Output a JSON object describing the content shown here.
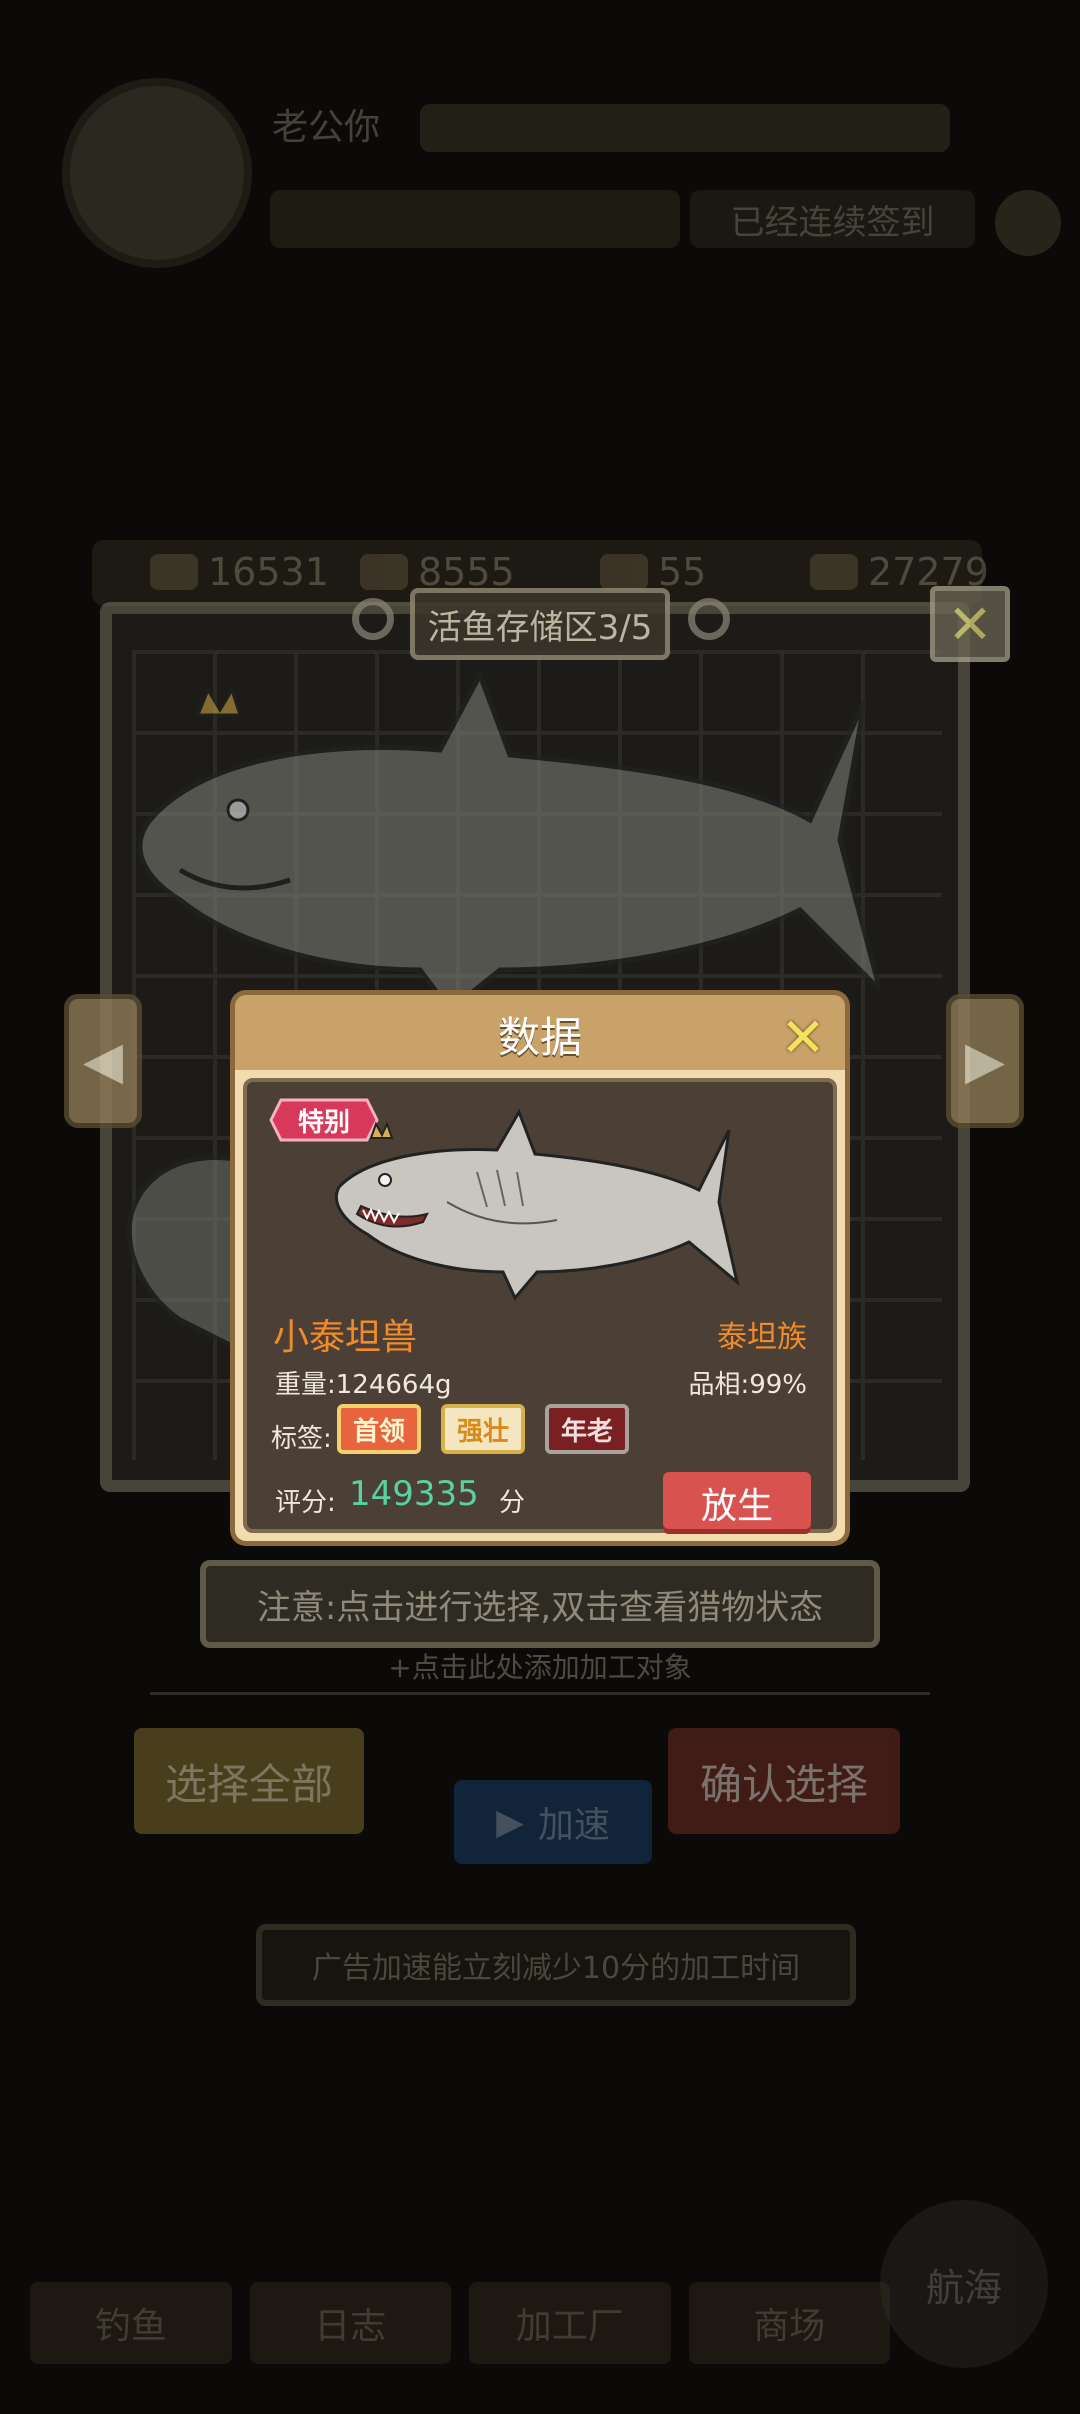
{
  "hud": {
    "name": "老公你",
    "pill": "已经连续签到"
  },
  "resources": [
    {
      "icon": "fish-icon",
      "value": "16531"
    },
    {
      "icon": "shell-icon",
      "value": "8555"
    },
    {
      "icon": "tool-icon",
      "value": "55"
    },
    {
      "icon": "coin-icon",
      "value": "27279"
    }
  ],
  "storage": {
    "title": "活鱼存储区3/5",
    "close": "✕"
  },
  "modal": {
    "title": "数据",
    "close": "✕",
    "badge": "特别",
    "fish_name": "小泰坦兽",
    "family": "泰坦族",
    "weight": "重量:124664g",
    "quality": "品相:99%",
    "tags_label": "标签:",
    "tags": [
      "首领",
      "强壮",
      "年老"
    ],
    "score_label": "评分:",
    "score_value": "149335",
    "score_unit": "分",
    "release": "放生"
  },
  "notice": "注意:点击进行选择,双击查看猎物状态",
  "add_target": "+点击此处添加加工对象",
  "buttons": {
    "select_all": "选择全部",
    "confirm": "确认选择",
    "speed": "加速"
  },
  "ad_hint": "广告加速能立刻减少10分的加工时间",
  "bottom_nav": [
    "钓鱼",
    "日志",
    "加工厂",
    "商场"
  ],
  "fab": "航海",
  "colors": {
    "accent_orange": "#f18b2a",
    "score_green": "#58d2a3",
    "release_red": "#d8534f",
    "modal_header": "#c8a269"
  }
}
